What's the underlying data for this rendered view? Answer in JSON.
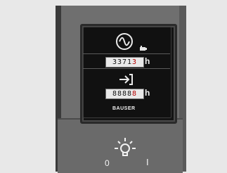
{
  "device": {
    "brand": "BAUSER",
    "counters": [
      {
        "digits": "3371",
        "last_digit": "3",
        "unit": "h"
      },
      {
        "digits": "8888",
        "last_digit": "8",
        "unit": "h"
      }
    ],
    "icons": [
      "sine-wave-icon",
      "key-icon",
      "arrow-enter-icon",
      "lamp-icon"
    ]
  },
  "switch": {
    "off_label": "0",
    "on_label": "I"
  }
}
